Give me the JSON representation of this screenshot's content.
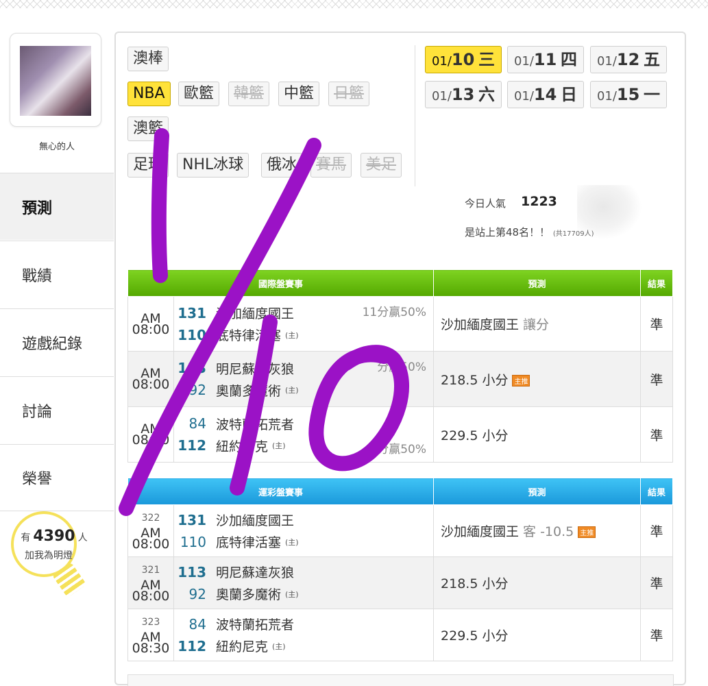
{
  "user": {
    "name": "無心的人"
  },
  "nav": [
    {
      "label": "預測",
      "active": true
    },
    {
      "label": "戰績"
    },
    {
      "label": "遊戲紀錄"
    },
    {
      "label": "討論"
    },
    {
      "label": "榮譽"
    }
  ],
  "fans": {
    "prefix": "有",
    "count": "4390",
    "suffix": "人",
    "cta": "加我為明燈"
  },
  "categories": {
    "row1": [
      "澳棒"
    ],
    "row2": [
      "NBA",
      "歐籃",
      "韓籃",
      "中籃",
      "日籃"
    ],
    "row3": [
      "澳籃"
    ],
    "row4": [
      "足球",
      "NHL冰球",
      "俄冰",
      "賽馬",
      "美足"
    ],
    "active": "NBA",
    "disabled": [
      "韓籃",
      "日籃",
      "賽馬",
      "美足"
    ]
  },
  "dates": [
    {
      "md": "01/",
      "day": "10",
      "wd": "三",
      "active": true
    },
    {
      "md": "01/",
      "day": "11",
      "wd": "四"
    },
    {
      "md": "01/",
      "day": "12",
      "wd": "五"
    },
    {
      "md": "01/",
      "day": "13",
      "wd": "六"
    },
    {
      "md": "01/",
      "day": "14",
      "wd": "日"
    },
    {
      "md": "01/",
      "day": "15",
      "wd": "一"
    }
  ],
  "popularity": {
    "label": "今日人氣",
    "value": "1223",
    "rank_text": "是站上第48名！！",
    "rank_total": "(共17709人)"
  },
  "intl": {
    "header": "國際盤賽事",
    "pred_header": "預測",
    "res_header": "結果",
    "rows": [
      {
        "time": "AM 08:00",
        "away_score": "131",
        "away": "沙加緬度國王",
        "home_score": "110",
        "home": "底特律活塞",
        "home_tag": "(主)",
        "spread": "11分贏50%",
        "pred": "沙加緬度國王",
        "pred_note": "讓分",
        "badge": "",
        "result": "準"
      },
      {
        "time": "AM 08:00",
        "away_score": "113",
        "away": "明尼蘇達灰狼",
        "home_score": "92",
        "home": "奧蘭多魔術",
        "home_tag": "(主)",
        "spread": "分贏50%",
        "pred": "218.5 小分",
        "pred_note": "",
        "badge": "主推",
        "result": "準"
      },
      {
        "time": "AM 08:30",
        "away_score": "84",
        "away": "波特蘭拓荒者",
        "home_score": "112",
        "home": "紐約尼克",
        "home_tag": "(主)",
        "spread": "分贏50%",
        "pred": "229.5 小分",
        "pred_note": "",
        "badge": "",
        "result": "準"
      }
    ]
  },
  "lottery": {
    "header": "運彩盤賽事",
    "pred_header": "預測",
    "res_header": "結果",
    "rows": [
      {
        "num": "322",
        "time": "AM 08:00",
        "away_score": "131",
        "away": "沙加緬度國王",
        "home_score": "110",
        "home": "底特律活塞",
        "home_tag": "(主)",
        "pred": "沙加緬度國王",
        "pred_note": "客 -10.5",
        "badge": "主推",
        "result": "準"
      },
      {
        "num": "321",
        "time": "AM 08:00",
        "away_score": "113",
        "away": "明尼蘇達灰狼",
        "home_score": "92",
        "home": "奧蘭多魔術",
        "home_tag": "(主)",
        "pred": "218.5 小分",
        "pred_note": "",
        "badge": "",
        "result": "準"
      },
      {
        "num": "323",
        "time": "AM 08:30",
        "away_score": "84",
        "away": "波特蘭拓荒者",
        "home_score": "112",
        "home": "紐約尼克",
        "home_tag": "(主)",
        "pred": "229.5 小分",
        "pred_note": "",
        "badge": "",
        "result": "準"
      }
    ]
  },
  "annotation": {
    "text": "1/10",
    "color": "#9b12c6"
  }
}
